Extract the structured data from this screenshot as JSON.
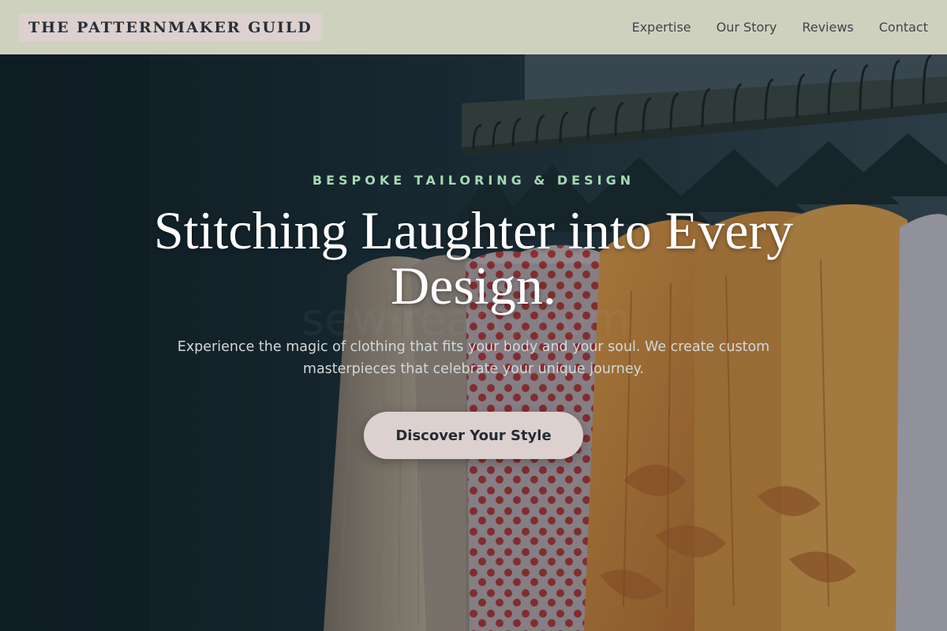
{
  "header": {
    "brand": "THE PATTERNMAKER GUILD",
    "nav": [
      "Expertise",
      "Our Story",
      "Reviews",
      "Contact"
    ]
  },
  "hero": {
    "eyebrow": "BESPOKE TAILORING & DESIGN",
    "headline": "Stitching Laughter into Every Design.",
    "subtext": "Experience the magic of clothing that fits your body and your soul. We create custom masterpieces that celebrate your unique journey.",
    "cta_label": "Discover Your Style",
    "background_image": "clothing-rack-hangers-photo"
  },
  "colors": {
    "header_bg": "#cfd1bf",
    "brand_bg": "#dcd1cf",
    "eyebrow": "#a6d9b3",
    "cta_bg": "#dcd1cf",
    "hero_dark": "#16252c"
  }
}
